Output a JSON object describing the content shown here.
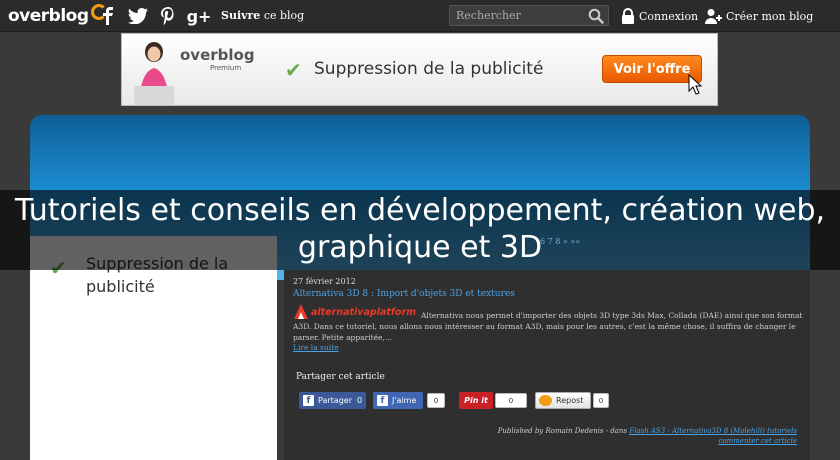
{
  "topbar": {
    "logo": "overblog",
    "follow_prefix": "Suivre",
    "follow_suffix": "ce blog",
    "search_placeholder": "Rechercher",
    "login": "Connexion",
    "create_blog": "Créer mon blog",
    "social_icons": [
      "facebook-icon",
      "twitter-icon",
      "pinterest-icon",
      "google-plus-icon"
    ]
  },
  "banner": {
    "logo": "overblog",
    "premium": "Premium",
    "text": "Suppression de la publicité",
    "cta": "Voir l'offre"
  },
  "site": {
    "title": "Tutoriels et conseils en développement, création web, graphique et 3D"
  },
  "sidebar_ad": {
    "text": "Suppression de la publicité"
  },
  "content": {
    "pager": "6 7 8 » »»",
    "post": {
      "date": "27 février 2012",
      "title": "Alternativa 3D 8 : Import d'objets 3D et textures",
      "logo_text": "alternativaplatform",
      "body": "Alternativa nous permet d'importer des objets 3D type 3ds Max, Collada (DAE) ainsi que son format A3D. Dans ce tutoriel, nous allons nous intéresser au format A3D, mais pour les autres, c'est la même chose, il suffira de changer le parser. Petite apparitée,...",
      "read_more": "Lire la suite"
    },
    "share": {
      "label": "Partager cet article",
      "facebook_label": "Partager",
      "facebook_count": "0",
      "like_label": "J'aime",
      "like_count": "0",
      "pin_label": "Pin it",
      "pin_count": "0",
      "repost_label": "Repost",
      "repost_count": "0"
    },
    "byline_prefix": "Published by Romain Dedenis - dans",
    "byline_category": "Flash AS3 - Alternativa3D 8 (Molehill) tutoriels",
    "comment": "commenter cet article"
  },
  "colors": {
    "topbar": "#2b2b2b",
    "accent_blue": "#1c8cd0",
    "link": "#4aa3e6",
    "cta_orange": "#f07010"
  }
}
